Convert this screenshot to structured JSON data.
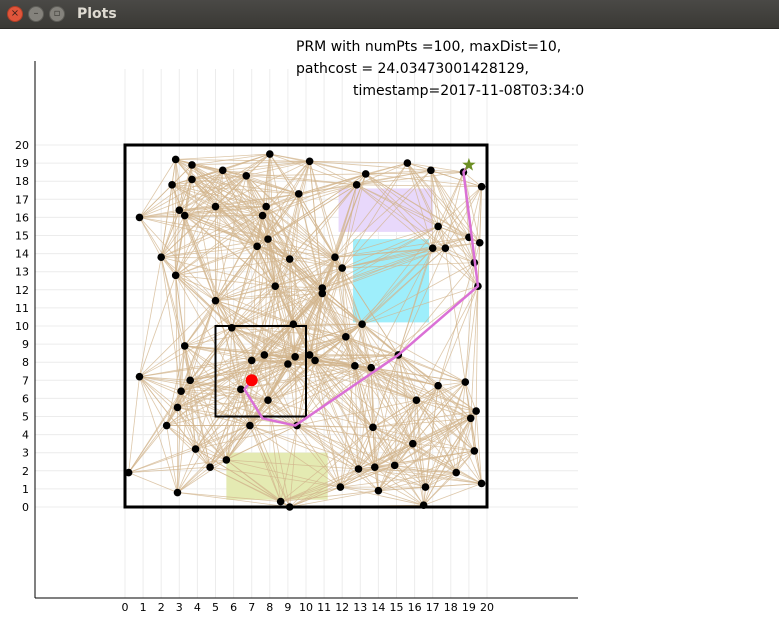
{
  "window": {
    "title": "Plots",
    "close_glyph": "×",
    "minimize_glyph": "–",
    "maximize_glyph": "▫"
  },
  "chart_data": {
    "type": "scatter",
    "annotation": [
      "PRM with numPts =100, maxDist=10,",
      "pathcost = 24.03473001428129,",
      "timestamp=2017-11-08T03:34:0"
    ],
    "xlim": [
      0,
      20
    ],
    "ylim": [
      0,
      20
    ],
    "x_ticks": [
      0,
      1,
      2,
      3,
      4,
      5,
      6,
      7,
      8,
      9,
      10,
      11,
      12,
      13,
      14,
      15,
      16,
      17,
      18,
      19,
      20
    ],
    "y_ticks": [
      0,
      1,
      2,
      3,
      4,
      5,
      6,
      7,
      8,
      9,
      10,
      11,
      12,
      13,
      14,
      15,
      16,
      17,
      18,
      19,
      20
    ],
    "grid": true,
    "colors": {
      "edges": "#d2b48c",
      "nodes": "#000000",
      "path": "#da70d6",
      "start": "#ff0000",
      "goal": "#6b8e23",
      "frame": "#000000"
    },
    "bounds": {
      "x": 0,
      "y": 0,
      "w": 20,
      "h": 20
    },
    "inner_box": {
      "x": 5,
      "y": 5,
      "w": 5,
      "h": 5
    },
    "obstacles": [
      {
        "x": 11.8,
        "y": 15.2,
        "w": 5.2,
        "h": 2.4,
        "color": "#e8d8fb"
      },
      {
        "x": 12.6,
        "y": 10.2,
        "w": 4.2,
        "h": 4.6,
        "color": "#9eeefb"
      },
      {
        "x": 5.6,
        "y": 0.4,
        "w": 5.6,
        "h": 2.6,
        "color": "#e4eab2"
      }
    ],
    "nodes": [
      [
        2.8,
        19.2
      ],
      [
        3.7,
        18.9
      ],
      [
        5.4,
        18.6
      ],
      [
        6.7,
        18.3
      ],
      [
        8.0,
        19.5
      ],
      [
        10.2,
        19.1
      ],
      [
        13.3,
        18.4
      ],
      [
        15.6,
        19.0
      ],
      [
        16.9,
        18.6
      ],
      [
        18.7,
        18.5
      ],
      [
        2.6,
        17.8
      ],
      [
        3.7,
        18.1
      ],
      [
        9.6,
        17.3
      ],
      [
        12.8,
        17.8
      ],
      [
        19.7,
        17.7
      ],
      [
        0.8,
        16.0
      ],
      [
        3.0,
        16.4
      ],
      [
        3.3,
        16.1
      ],
      [
        5.0,
        16.6
      ],
      [
        7.8,
        16.6
      ],
      [
        7.6,
        16.1
      ],
      [
        17.3,
        15.5
      ],
      [
        19.0,
        14.9
      ],
      [
        17.0,
        14.3
      ],
      [
        17.7,
        14.3
      ],
      [
        19.6,
        14.6
      ],
      [
        2.0,
        13.8
      ],
      [
        7.3,
        14.4
      ],
      [
        7.9,
        14.8
      ],
      [
        9.1,
        13.7
      ],
      [
        11.6,
        13.8
      ],
      [
        12.0,
        13.2
      ],
      [
        2.8,
        12.8
      ],
      [
        8.3,
        12.2
      ],
      [
        10.9,
        11.8
      ],
      [
        10.9,
        12.1
      ],
      [
        19.3,
        13.5
      ],
      [
        19.5,
        12.2
      ],
      [
        5.0,
        11.4
      ],
      [
        9.3,
        10.1
      ],
      [
        5.9,
        9.9
      ],
      [
        13.1,
        10.1
      ],
      [
        12.2,
        9.4
      ],
      [
        3.3,
        8.9
      ],
      [
        7.0,
        8.1
      ],
      [
        7.7,
        8.4
      ],
      [
        9.4,
        8.3
      ],
      [
        10.2,
        8.4
      ],
      [
        10.5,
        8.1
      ],
      [
        9.0,
        7.9
      ],
      [
        12.7,
        7.8
      ],
      [
        13.6,
        7.7
      ],
      [
        15.1,
        8.4
      ],
      [
        0.8,
        7.2
      ],
      [
        3.6,
        7.0
      ],
      [
        6.4,
        6.5
      ],
      [
        3.1,
        6.4
      ],
      [
        17.3,
        6.7
      ],
      [
        18.8,
        6.9
      ],
      [
        2.9,
        5.5
      ],
      [
        16.1,
        5.9
      ],
      [
        7.9,
        5.9
      ],
      [
        19.4,
        5.3
      ],
      [
        19.1,
        4.9
      ],
      [
        2.3,
        4.5
      ],
      [
        6.9,
        4.5
      ],
      [
        13.7,
        4.4
      ],
      [
        9.5,
        4.5
      ],
      [
        3.9,
        3.2
      ],
      [
        15.9,
        3.5
      ],
      [
        19.3,
        3.1
      ],
      [
        0.2,
        1.9
      ],
      [
        4.7,
        2.2
      ],
      [
        5.6,
        2.6
      ],
      [
        12.9,
        2.1
      ],
      [
        13.8,
        2.2
      ],
      [
        14.9,
        2.3
      ],
      [
        18.3,
        1.9
      ],
      [
        19.7,
        1.3
      ],
      [
        11.9,
        1.1
      ],
      [
        2.9,
        0.8
      ],
      [
        14.0,
        0.9
      ],
      [
        16.6,
        1.1
      ],
      [
        8.6,
        0.3
      ],
      [
        9.1,
        0.0
      ],
      [
        16.5,
        0.1
      ]
    ],
    "path": [
      [
        19.0,
        18.9
      ],
      [
        18.7,
        18.5
      ],
      [
        19.5,
        12.2
      ],
      [
        15.1,
        8.4
      ],
      [
        9.4,
        4.5
      ],
      [
        7.6,
        4.9
      ],
      [
        6.6,
        6.5
      ],
      [
        7.0,
        7.0
      ]
    ],
    "start": [
      7.0,
      7.0
    ],
    "goal": [
      19.0,
      18.9
    ]
  }
}
